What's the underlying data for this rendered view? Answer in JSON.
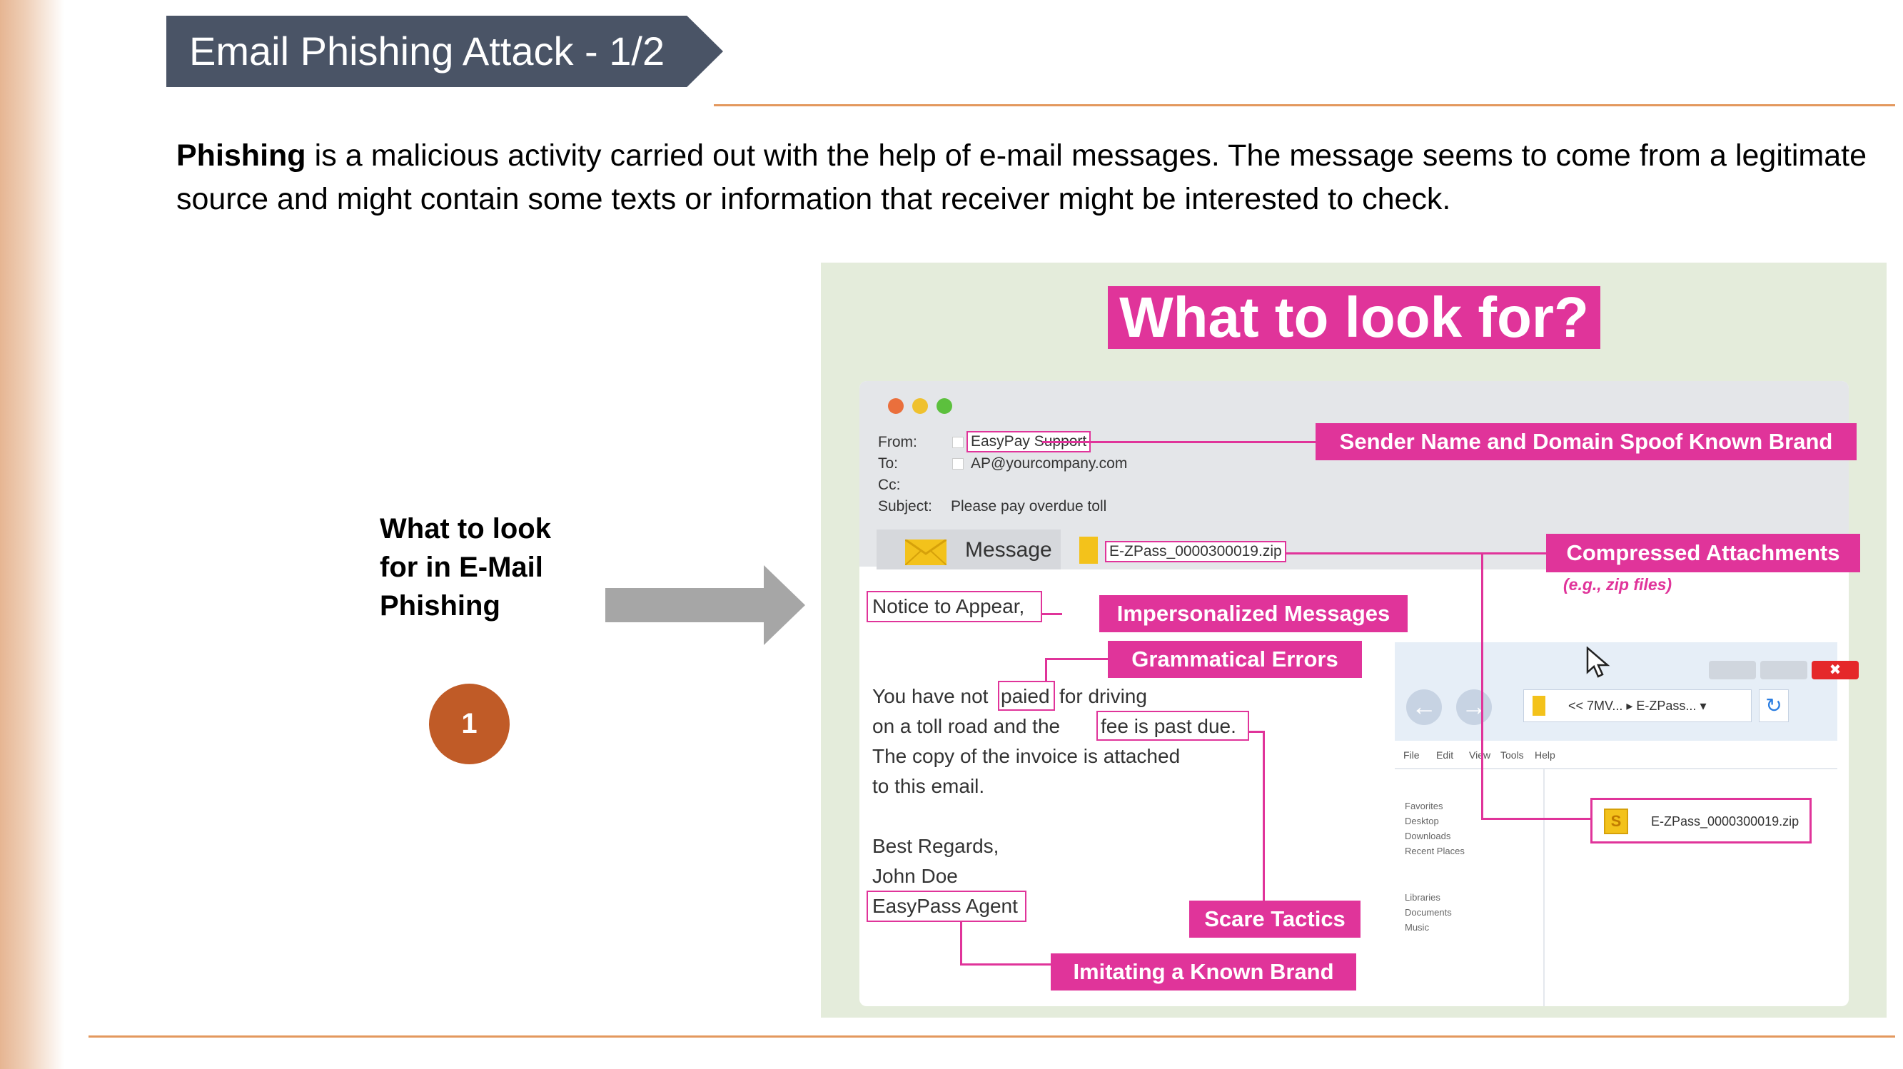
{
  "slide": {
    "title": "Email Phishing Attack - 1/2",
    "intro_term": "Phishing",
    "intro_rest": " is a malicious activity carried out with the help of e-mail messages. The message seems to come from a legitimate source and might contain some texts or information that receiver might be interested to check.",
    "left_heading_lines": [
      "What to look",
      "for in  E-Mail",
      "Phishing"
    ],
    "badge": "1"
  },
  "infographic": {
    "title": "What to look for?",
    "header": {
      "from_label": "From:",
      "from_value": "EasyPay Support",
      "to_label": "To:",
      "to_value": "AP@yourcompany.com",
      "cc_label": "Cc:",
      "subject_label": "Subject:",
      "subject_value": "Please pay overdue toll"
    },
    "tab_label": "Message",
    "attachment_name": "E-ZPass_0000300019.zip",
    "body": {
      "greeting": "Notice to Appear,",
      "line1_a": "You have not",
      "line1_word": "paied",
      "line1_b": "for driving",
      "line2_a": "on a toll road and the",
      "line2_phrase": "fee is past due.",
      "line3": "The copy of the invoice is attached",
      "line4": "to this email.",
      "closing": "Best Regards,",
      "name": "John Doe",
      "signature": "EasyPass Agent"
    },
    "callouts": {
      "sender": "Sender Name and Domain Spoof Known Brand",
      "attachments": "Compressed Attachments",
      "attachments_note": "(e.g., zip files)",
      "impersonal": "Impersonalized Messages",
      "grammar": "Grammatical Errors",
      "scare": "Scare Tactics",
      "brand": "Imitating a Known Brand"
    },
    "explorer": {
      "address_text": "<< 7MV...  ▸  E-ZPass...  ▾",
      "menu": [
        "File",
        "Edit",
        "View",
        "Tools",
        "Help"
      ],
      "tree": [
        "Favorites",
        "Desktop",
        "Downloads",
        "Recent Places",
        "Libraries",
        "Documents",
        "Music"
      ],
      "file_name": "E-ZPass_0000300019.zip"
    }
  }
}
